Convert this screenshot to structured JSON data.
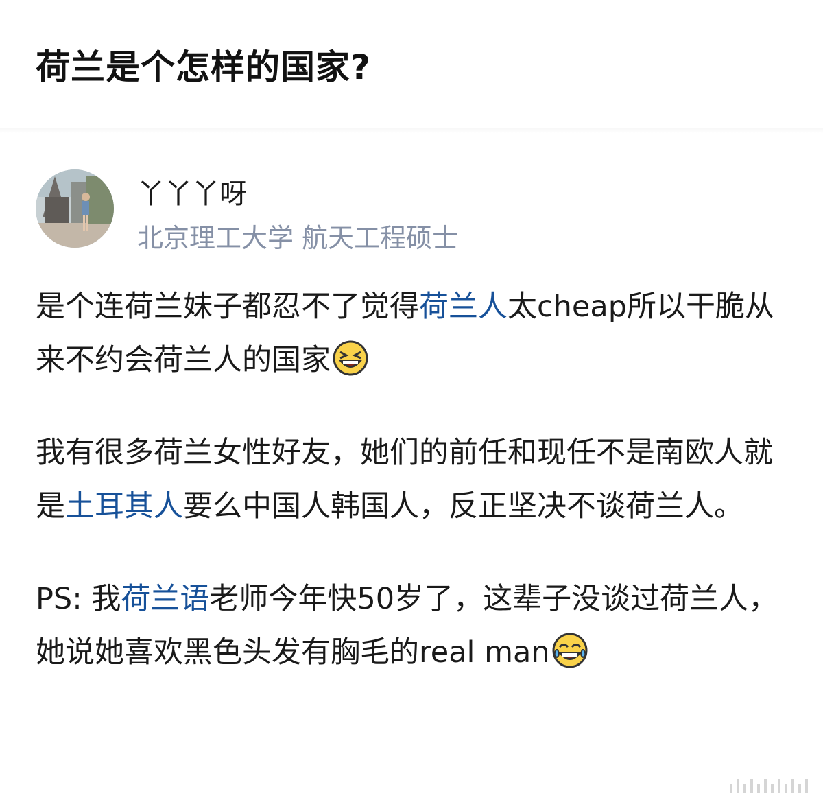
{
  "question": {
    "title": "荷兰是个怎样的国家?"
  },
  "author": {
    "name": "丫丫丫呀",
    "bio": "北京理工大学 航天工程硕士",
    "avatar_icon": "avatar-photo"
  },
  "answer": {
    "p1": {
      "t1": "是个连荷兰妹子都忍不了觉得",
      "link1": "荷兰人",
      "t2": "太cheap所以干脆从来不约会荷兰人的国家",
      "emoji": "laughing-face-icon"
    },
    "p2": {
      "t1": "我有很多荷兰女性好友，她们的前任和现任不是南欧人就是",
      "link1": "土耳其人",
      "t2": "要么中国人韩国人，反正坚决不谈荷兰人。"
    },
    "p3": {
      "t1": "PS: 我",
      "link1": "荷兰语",
      "t2": "老师今年快50岁了，这辈子没谈过荷兰人，她说她喜欢黑色头发有胸毛的real man",
      "emoji": "tears-of-joy-face-icon"
    }
  },
  "colors": {
    "link": "#175199",
    "bio": "#8590a6",
    "text": "#1a1a1a"
  }
}
